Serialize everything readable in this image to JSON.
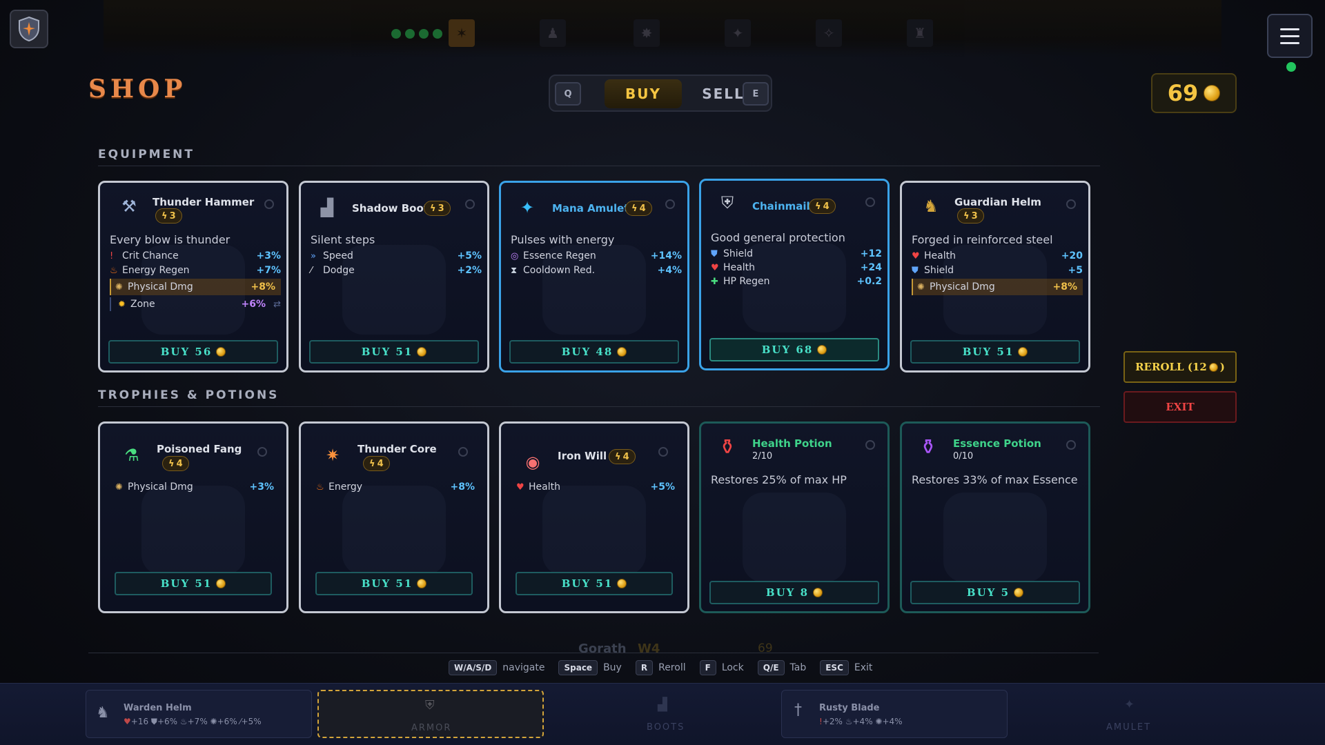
{
  "header": {
    "title": "SHOP",
    "tabs": {
      "prev_key": "Q",
      "buy": "BUY",
      "sell": "SELL",
      "next_key": "E"
    },
    "gold": "69"
  },
  "sections": {
    "equipment": "EQUIPMENT",
    "trophies": "TROPHIES & POTIONS"
  },
  "equipment": [
    {
      "name": "Thunder Hammer",
      "tier": "3",
      "desc": "Every blow is thunder",
      "stats": [
        {
          "label": "Crit Chance",
          "value": "+3%",
          "icon": "crit-icon"
        },
        {
          "label": "Energy Regen",
          "value": "+7%",
          "icon": "flame-icon"
        },
        {
          "label": "Physical Dmg",
          "value": "+8%",
          "icon": "physical-icon",
          "highlight": true
        },
        {
          "label": "Zone",
          "value": "+6%",
          "icon": "zone-icon",
          "purple": true
        }
      ],
      "buy": "BUY 56"
    },
    {
      "name": "Shadow Boot",
      "tier": "3",
      "desc": "Silent steps",
      "stats": [
        {
          "label": "Speed",
          "value": "+5%",
          "icon": "speed-icon"
        },
        {
          "label": "Dodge",
          "value": "+2%",
          "icon": "dodge-icon"
        }
      ],
      "buy": "BUY 51"
    },
    {
      "name": "Mana Amulet",
      "tier": "4",
      "desc": "Pulses with energy",
      "stats": [
        {
          "label": "Essence Regen",
          "value": "+14%",
          "icon": "essence-icon"
        },
        {
          "label": "Cooldown Red.",
          "value": "+4%",
          "icon": "hourglass-icon"
        }
      ],
      "buy": "BUY 48"
    },
    {
      "name": "Chainmail",
      "tier": "4",
      "desc": "Good general protection",
      "stats": [
        {
          "label": "Shield",
          "value": "+12",
          "icon": "shield-icon"
        },
        {
          "label": "Health",
          "value": "+24",
          "icon": "heart-icon"
        },
        {
          "label": "HP Regen",
          "value": "+0.2",
          "icon": "plus-icon"
        }
      ],
      "buy": "BUY 68"
    },
    {
      "name": "Guardian Helm",
      "tier": "3",
      "desc": "Forged in reinforced steel",
      "stats": [
        {
          "label": "Health",
          "value": "+20",
          "icon": "heart-icon"
        },
        {
          "label": "Shield",
          "value": "+5",
          "icon": "shield-icon"
        },
        {
          "label": "Physical Dmg",
          "value": "+8%",
          "icon": "physical-icon",
          "highlight": true
        }
      ],
      "buy": "BUY 51"
    }
  ],
  "trophies": [
    {
      "name": "Poisoned Fang",
      "tier": "4",
      "stat": {
        "label": "Physical Dmg",
        "value": "+3%"
      },
      "buy": "BUY 51"
    },
    {
      "name": "Thunder Core",
      "tier": "4",
      "stat": {
        "label": "Energy",
        "value": "+8%"
      },
      "buy": "BUY 51"
    },
    {
      "name": "Iron Will",
      "tier": "4",
      "stat": {
        "label": "Health",
        "value": "+5%"
      },
      "buy": "BUY 51"
    }
  ],
  "potions": [
    {
      "name": "Health Potion",
      "count": "2/10",
      "desc": "Restores 25% of max HP",
      "buy": "BUY 8"
    },
    {
      "name": "Essence Potion",
      "count": "0/10",
      "desc": "Restores 33% of max Essence",
      "buy": "BUY 5"
    }
  ],
  "actions": {
    "reroll": "REROLL (12",
    "reroll_close": ")",
    "exit": "EXIT"
  },
  "hints": [
    {
      "key": "W/A/S/D",
      "label": "navigate"
    },
    {
      "key": "Space",
      "label": "Buy"
    },
    {
      "key": "R",
      "label": "Reroll"
    },
    {
      "key": "F",
      "label": "Lock"
    },
    {
      "key": "Q/E",
      "label": "Tab"
    },
    {
      "key": "ESC",
      "label": "Exit"
    }
  ],
  "background": {
    "player_name": "Gorath",
    "wave": "W4",
    "gold": "69"
  },
  "equipped": {
    "helm": {
      "name": "Warden Helm",
      "stats": [
        "+16",
        "+6%",
        "+7%",
        "+6%",
        "+5%"
      ]
    },
    "armor_label": "ARMOR",
    "boots_label": "BOOTS",
    "weapon": {
      "name": "Rusty Blade",
      "stats": [
        "+2%",
        "+4%",
        "+4%"
      ]
    },
    "amulet_label": "AMULET"
  },
  "colors": {
    "accent_gold": "#f5c542",
    "teal": "#48e0c8",
    "blue_border": "#3aa2e8",
    "exit_red": "#ef4444"
  }
}
